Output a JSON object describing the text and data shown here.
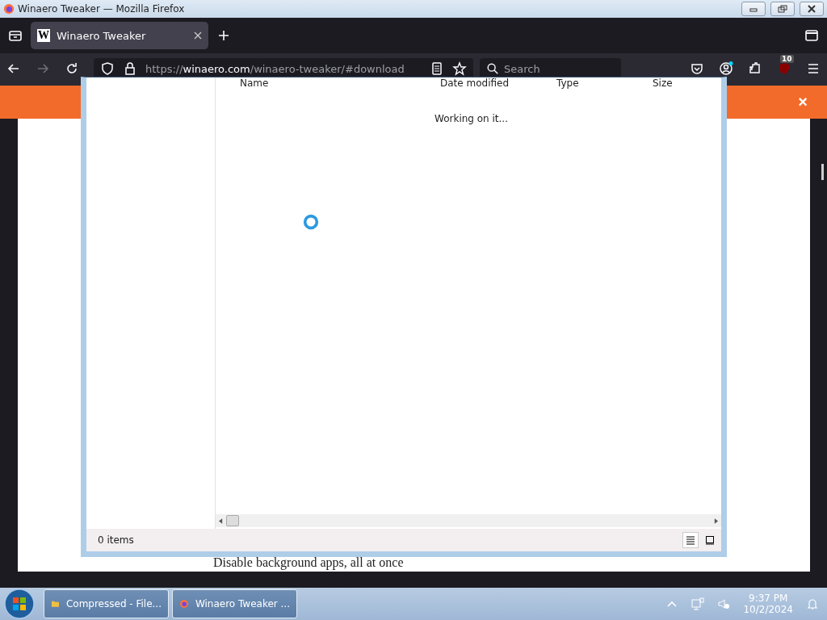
{
  "window": {
    "title": "Winaero Tweaker — Mozilla Firefox"
  },
  "tabs": [
    {
      "label": "Winaero Tweaker",
      "favicon": "W",
      "selected": true
    }
  ],
  "address_bar": {
    "url_prefix": "https://",
    "url_host": "winaero.com",
    "url_path": "/winaero-tweaker/#download"
  },
  "search": {
    "placeholder": "Search"
  },
  "extension_badge": "10",
  "banner": {
    "close": "×"
  },
  "page_text": "Disable background apps, all at once",
  "dialog": {
    "columns": [
      "Name",
      "Date modified",
      "Type",
      "Size"
    ],
    "message": "Working on it...",
    "status": "0 items",
    "views": [
      {
        "kind": "details",
        "selected": true
      },
      {
        "kind": "tiles",
        "selected": false
      }
    ]
  },
  "taskbar": {
    "items": [
      {
        "kind": "folder",
        "label": "Compressed - File..."
      },
      {
        "kind": "browser",
        "label": "Winaero Tweaker ..."
      }
    ],
    "time": "9:37 PM",
    "date": "10/2/2024"
  }
}
